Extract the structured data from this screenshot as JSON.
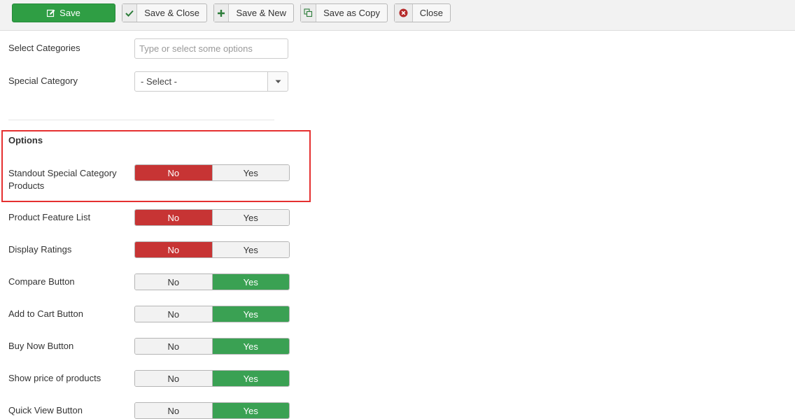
{
  "toolbar": {
    "save": "Save",
    "save_close": "Save & Close",
    "save_new": "Save & New",
    "save_copy": "Save as Copy",
    "close": "Close"
  },
  "form": {
    "select_categories": {
      "label": "Select Categories",
      "placeholder": "Type or select some options"
    },
    "special_category": {
      "label": "Special Category",
      "value": "- Select -"
    }
  },
  "options": {
    "title": "Options",
    "no_label": "No",
    "yes_label": "Yes",
    "rows": [
      {
        "label": "Standout Special Category Products",
        "value": "No"
      },
      {
        "label": "Product Feature List",
        "value": "No"
      },
      {
        "label": "Display Ratings",
        "value": "No"
      },
      {
        "label": "Compare Button",
        "value": "Yes"
      },
      {
        "label": "Add to Cart Button",
        "value": "Yes"
      },
      {
        "label": "Buy Now Button",
        "value": "Yes"
      },
      {
        "label": "Show price of products",
        "value": "Yes"
      },
      {
        "label": "Quick View Button",
        "value": "Yes"
      }
    ]
  },
  "colors": {
    "no_active": "#c73434",
    "yes_active": "#3aa153",
    "save": "#2f9e44",
    "highlight": "#e53030"
  }
}
